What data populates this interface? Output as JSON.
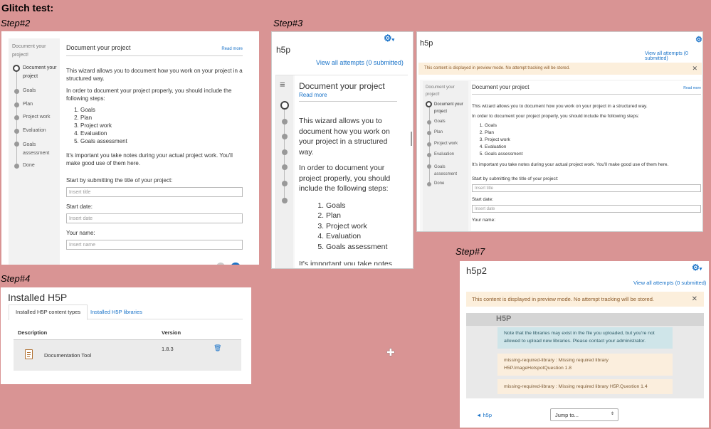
{
  "title": "Glitch test:",
  "captions": {
    "step2": "Step#2",
    "step3": "Step#3",
    "step4": "Step#4",
    "step7": "Step#7"
  },
  "step2": {
    "sidebar_title": "Document your project!",
    "steps": [
      "Document your project",
      "Goals",
      "Plan",
      "Project work",
      "Evaluation",
      "Goals assessment",
      "Done"
    ],
    "page_title": "Document your project",
    "read_more": "Read more",
    "intro": "This wizard allows you to document how you work on your project in a structured way.",
    "lead": "In order to document your project properly, you should include the following steps:",
    "list": [
      "Goals",
      "Plan",
      "Project work",
      "Evaluation",
      "Goals assessment"
    ],
    "note": "It's important you take notes during your actual project work. You'll make good use of them here.",
    "field1_label": "Start by submitting the title of your project:",
    "field1_placeholder": "Insert title",
    "field2_label": "Start date:",
    "field2_placeholder": "Insert date",
    "field3_label": "Your name:",
    "field3_placeholder": "Insert name"
  },
  "step3": {
    "heading": "h5p",
    "attempts": "View all attempts (0 submitted)",
    "page_title": "Document your project",
    "read_more": "Read more",
    "intro": "This wizard allows you to document how you work on your project in a structured way.",
    "lead": "In order to document your project properly, you should include the following steps:",
    "list": [
      "Goals",
      "Plan",
      "Project work",
      "Evaluation",
      "Goals assessment"
    ],
    "cut_text": "It's important you take notes"
  },
  "step3b": {
    "heading": "h5p",
    "attempts": "View all attempts (0 submitted)",
    "notice": "This content is displayed in preview mode. No attempt tracking will be stored.",
    "sidebar_title": "Document your project!",
    "steps": [
      "Document your project",
      "Goals",
      "Plan",
      "Project work",
      "Evaluation",
      "Goals assessment",
      "Done"
    ],
    "page_title": "Document your project",
    "read_more": "Read more",
    "intro": "This wizard allows you to document how you work on your project in a structured way.",
    "lead": "In order to document your project properly, you should include the following steps:",
    "list": [
      "Goals",
      "Plan",
      "Project work",
      "Evaluation",
      "Goals assessment"
    ],
    "note": "It's important you take notes during your actual project work. You'll make good use of them here.",
    "field1_label": "Start by submitting the title of your project:",
    "field1_placeholder": "Insert title",
    "field2_label": "Start date:",
    "field2_placeholder": "Insert date",
    "field3_label": "Your name:"
  },
  "step4": {
    "heading": "Installed H5P",
    "tab_types": "Installed H5P content types",
    "tab_libraries": "Installed H5P libraries",
    "col_description": "Description",
    "col_version": "Version",
    "row_name": "Documentation Tool",
    "row_version": "1.8.3"
  },
  "step7": {
    "heading": "h5p2",
    "attempts": "View all attempts (0 submitted)",
    "notice": "This content is displayed in preview mode. No attempt tracking will be stored.",
    "logo": "H5P",
    "info": "Note that the libraries may exist in the file you uploaded, but you're not allowed to upload new libraries. Please contact your administrator.",
    "error1": "missing-required-library : Missing required library H5P.ImageHotspotQuestion 1.8",
    "error2": "missing-required-library : Missing required library H5P.Question 1.4",
    "back_link": "◄ h5p",
    "jump": "Jump to..."
  }
}
